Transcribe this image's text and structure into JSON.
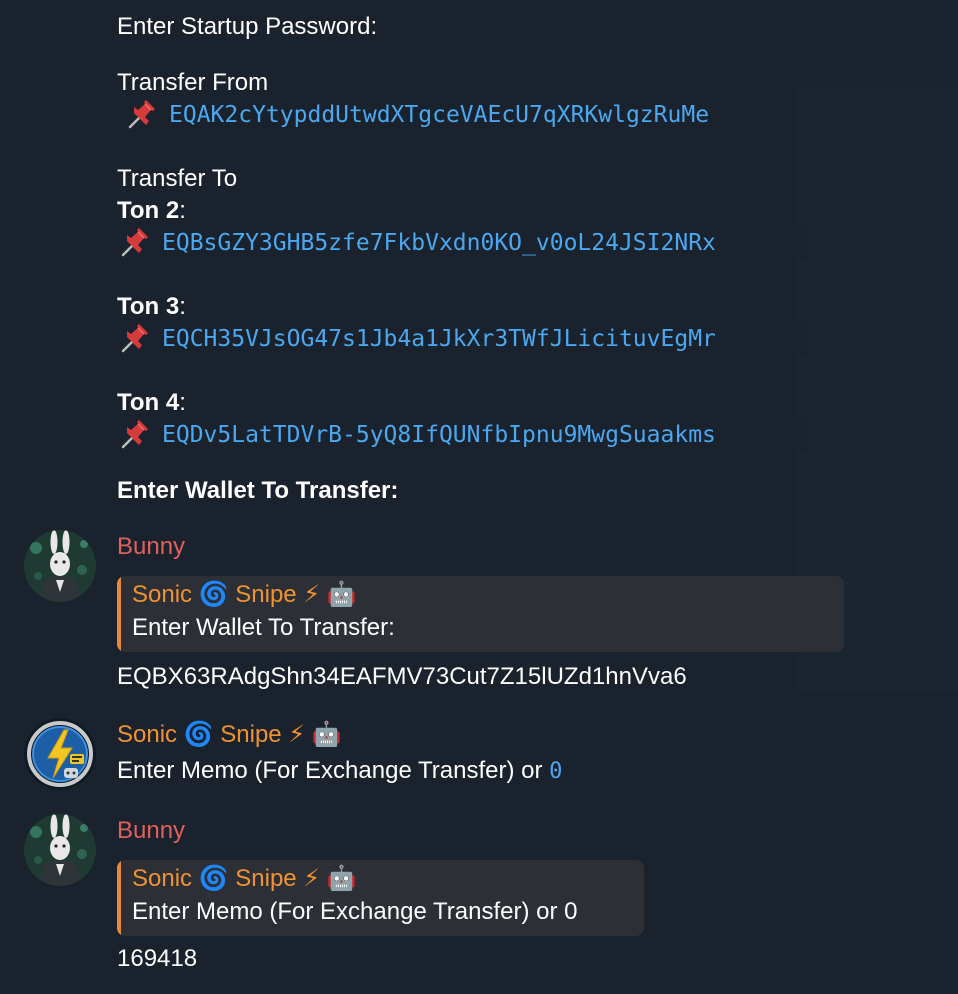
{
  "messages": {
    "startup_prompt": "Enter Startup Password:",
    "transfer_from_label": "Transfer From",
    "transfer_from_address": "EQAK2cYtypddUtwdXTgceVAEcU7qXRKwlgzRuMe",
    "transfer_to_label": "Transfer To",
    "wallets": [
      {
        "name": "Ton 2",
        "address": "EQBsGZY3GHB5zfe7FkbVxdn0KO_v0oL24JSI2NRx"
      },
      {
        "name": "Ton 3",
        "address": "EQCH35VJsOG47s1Jb4a1JkXr3TWfJLicituvEgMr"
      },
      {
        "name": "Ton 4",
        "address": "EQDv5LatTDVrB-5yQ8IfQUNfbIpnu9MwgSuaakms"
      }
    ],
    "colon": ":",
    "enter_wallet_prompt": "Enter Wallet To Transfer:"
  },
  "chat": [
    {
      "sender": "Bunny",
      "reply_to_sender": "Sonic 🌀 Snipe ⚡ 🤖",
      "reply_to_text": "Enter Wallet To Transfer:",
      "text": "EQBX63RAdgShn34EAFMV73Cut7Z15lUZd1hnVva6"
    },
    {
      "sender": "Sonic 🌀 Snipe ⚡ 🤖",
      "text": "Enter Memo (For Exchange Transfer) or ",
      "code": "0"
    },
    {
      "sender": "Bunny",
      "reply_to_sender": "Sonic 🌀 Snipe ⚡ 🤖",
      "reply_to_text": "Enter Memo (For Exchange Transfer) or 0",
      "text": "169418"
    }
  ],
  "colors": {
    "background": "#1a222d",
    "link": "#4aa8f0",
    "bunny_name": "#e0605c",
    "bot_name": "#f0932f",
    "reply_bar": "#e8893a"
  },
  "icons": {
    "pin": "pushpin-icon",
    "bunny_avatar": "rabbit-avatar",
    "bot_avatar": "lightning-bot-avatar"
  }
}
